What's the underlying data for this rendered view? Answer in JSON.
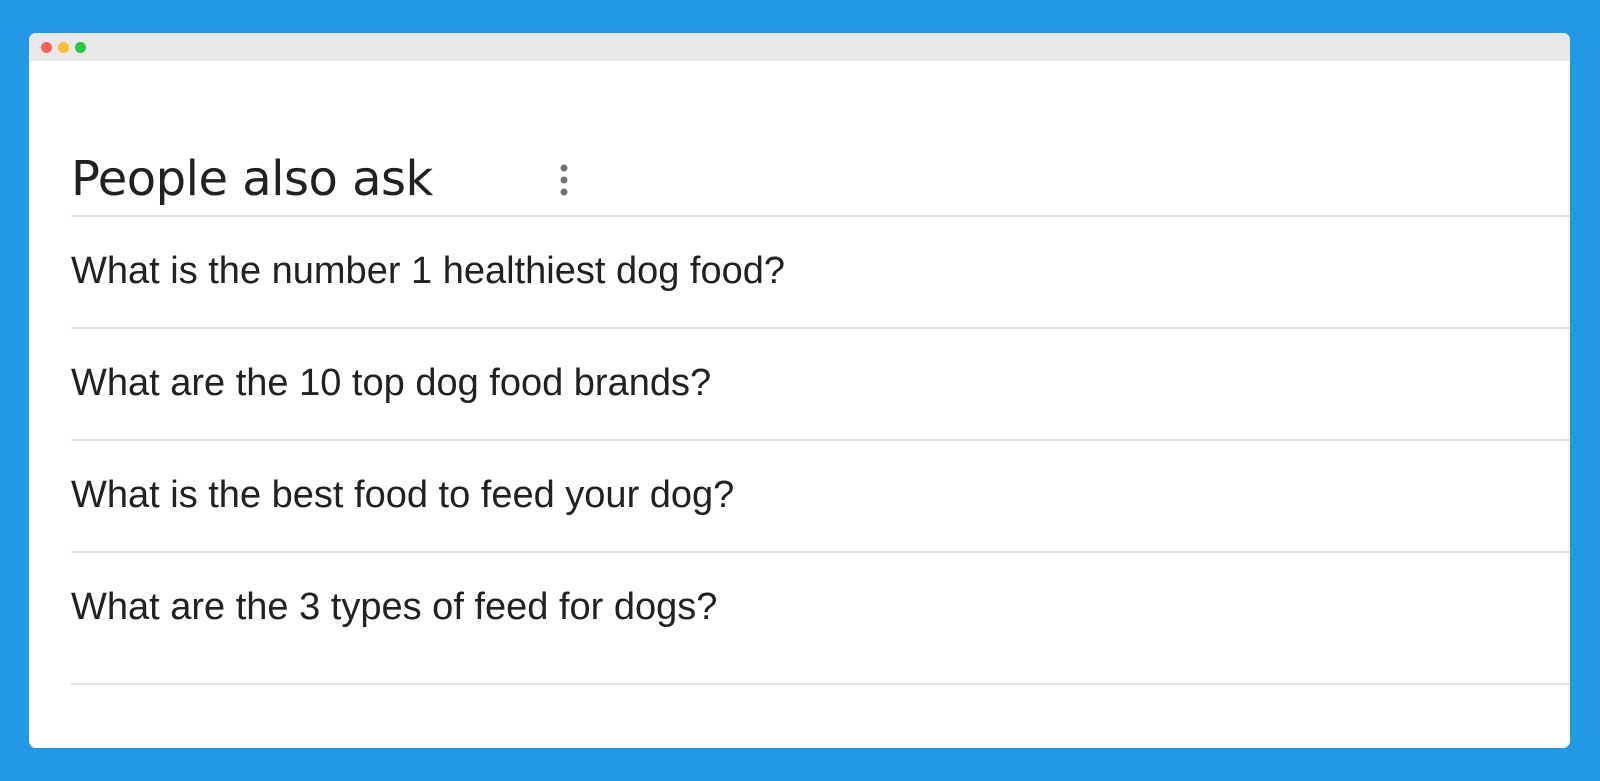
{
  "window": {
    "controls": [
      "close",
      "minimize",
      "zoom"
    ]
  },
  "paa": {
    "title": "People also ask",
    "more_icon": "more-vert-icon",
    "questions": [
      {
        "text": "What is the number 1 healthiest dog food?"
      },
      {
        "text": "What are the 10 top dog food brands?"
      },
      {
        "text": "What is the best food to feed your dog?"
      },
      {
        "text": "What are the 3 types of feed for dogs?"
      }
    ]
  },
  "colors": {
    "background": "#2399e5",
    "text": "#202124",
    "divider": "#e4e4e4",
    "close": "#fe5f57",
    "minimize": "#febc2e",
    "zoom": "#28c840"
  }
}
